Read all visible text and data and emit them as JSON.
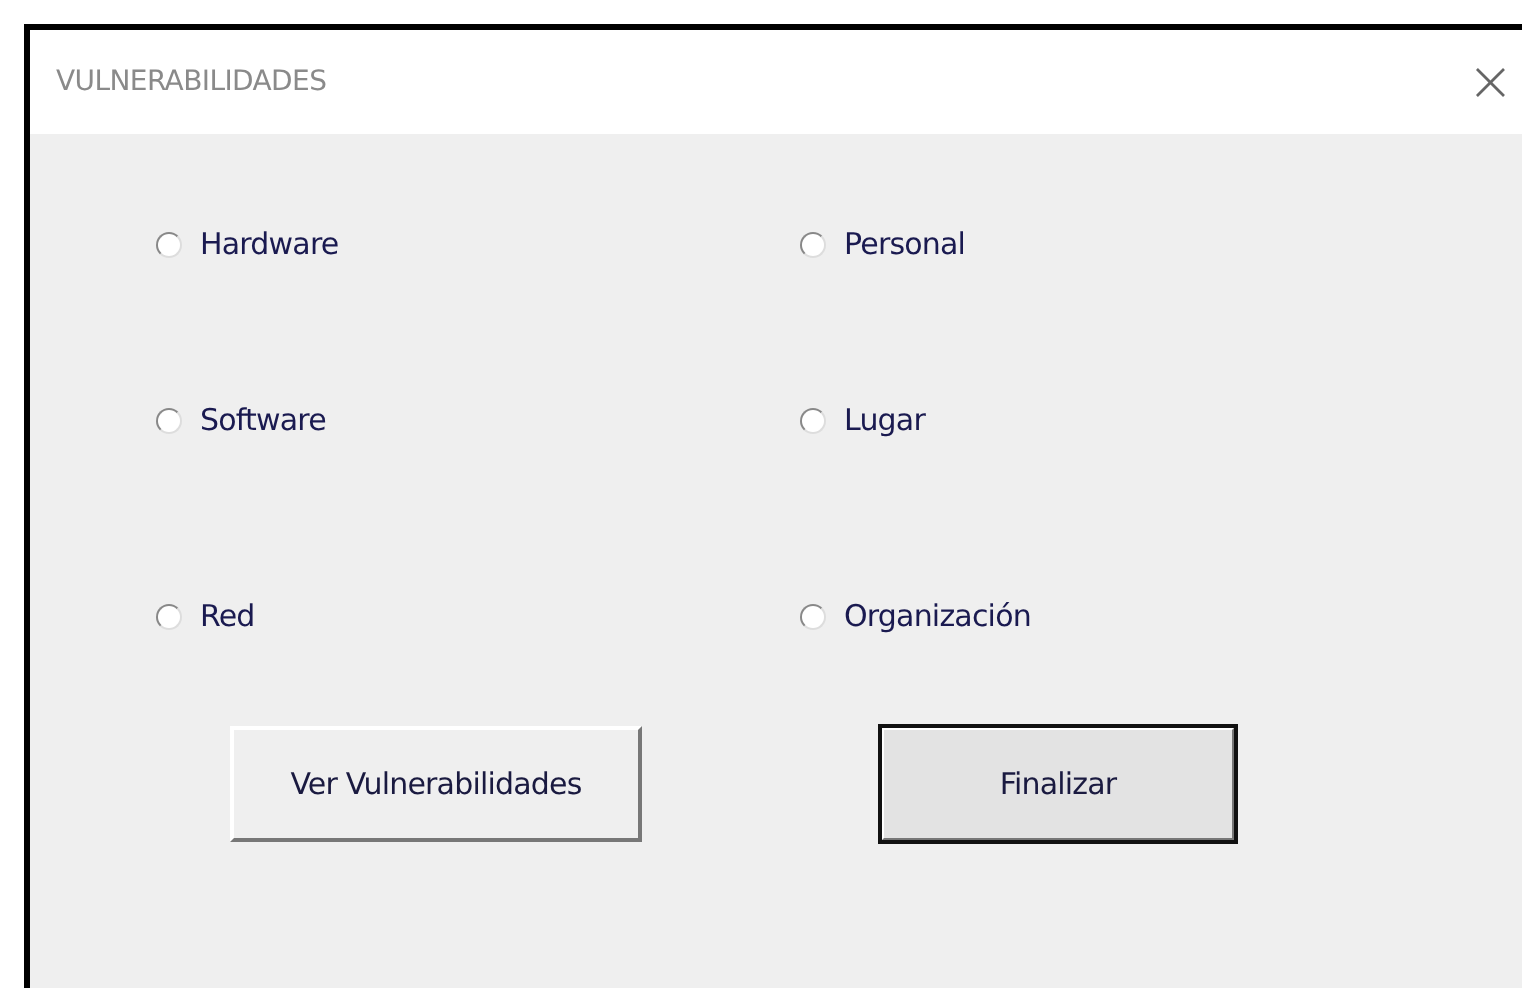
{
  "window": {
    "title": "VULNERABILIDADES",
    "close": "×"
  },
  "options": [
    {
      "label": "Hardware",
      "selected": false
    },
    {
      "label": "Personal",
      "selected": false
    },
    {
      "label": "Software",
      "selected": false
    },
    {
      "label": "Lugar",
      "selected": false
    },
    {
      "label": "Red",
      "selected": false
    },
    {
      "label": "Organización",
      "selected": false
    }
  ],
  "buttons": [
    {
      "label": "Ver Vulnerabilidades",
      "default": false
    },
    {
      "label": "Finalizar",
      "default": true
    }
  ]
}
